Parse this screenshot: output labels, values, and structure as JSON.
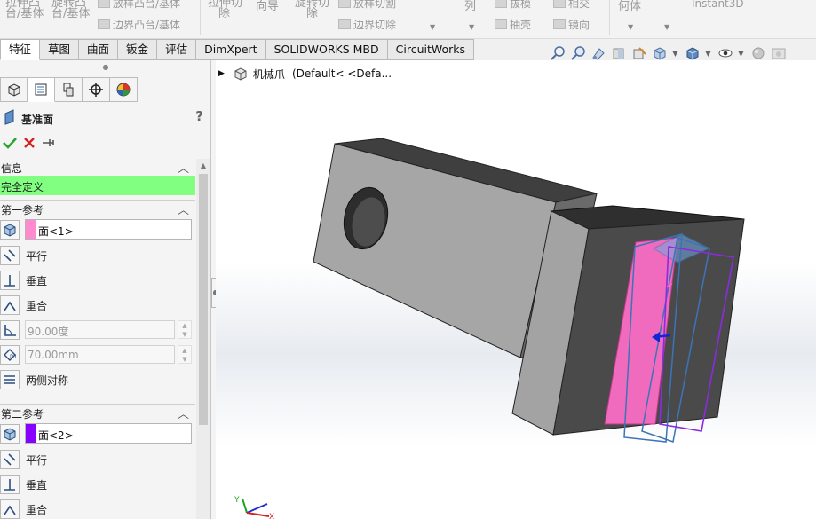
{
  "ribbon": {
    "items": [
      "拉伸凸",
      "台/基体",
      "旋转凸",
      "台/基体",
      "放样凸台/基体",
      "边界凸台/基体",
      "拉伸切",
      "除",
      "向导",
      "旋转切",
      "除",
      "放样切割",
      "边界切除",
      "列",
      "拔模",
      "抽壳",
      "相交",
      "镜向",
      "何体",
      "Instant3D"
    ]
  },
  "tabs": [
    "特征",
    "草图",
    "曲面",
    "钣金",
    "评估",
    "DimXpert",
    "SOLIDWORKS MBD",
    "CircuitWorks"
  ],
  "active_tab": "特征",
  "hud_icons": [
    "zoom-to-fit-icon",
    "zoom-area-icon",
    "previous-view-icon",
    "section-view-icon",
    "dynamic-annotation-icon",
    "view-orientation-icon",
    "display-style-icon",
    "hide-show-icon",
    "edit-appearance-icon",
    "apply-scene-icon"
  ],
  "panel_tabs": [
    "featuremanager-icon",
    "propertymanager-icon",
    "configurationmanager-icon",
    "dimxpert-icon",
    "display-manager-icon"
  ],
  "property_manager": {
    "title": "基准面",
    "help": "?",
    "message_group": {
      "header": "信息",
      "status": "完全定义",
      "status_color": "#80ff80"
    },
    "first_reference": {
      "header": "第一参考",
      "selection": "面<1>",
      "swatch_color": "#ff8ad0",
      "options": [
        "平行",
        "垂直",
        "重合"
      ],
      "angle": "90.00度",
      "distance": "70.00mm",
      "symmetric": "两侧对称"
    },
    "second_reference": {
      "header": "第二参考",
      "selection": "面<2>",
      "swatch_color": "#8800ff",
      "options": [
        "平行",
        "垂直",
        "重合"
      ]
    }
  },
  "viewport": {
    "tree_part": "机械爪",
    "tree_config": "(Default< <Defa..."
  },
  "colors": {
    "ok_green": "#2aa52a",
    "cancel_red": "#d42020",
    "plane_pink": "#f06bbd",
    "plane_blue": "#6fa8e0",
    "plane_purple": "#8a2be2",
    "body_dark": "#4a4a4a",
    "body_light": "#a6a6a6"
  }
}
